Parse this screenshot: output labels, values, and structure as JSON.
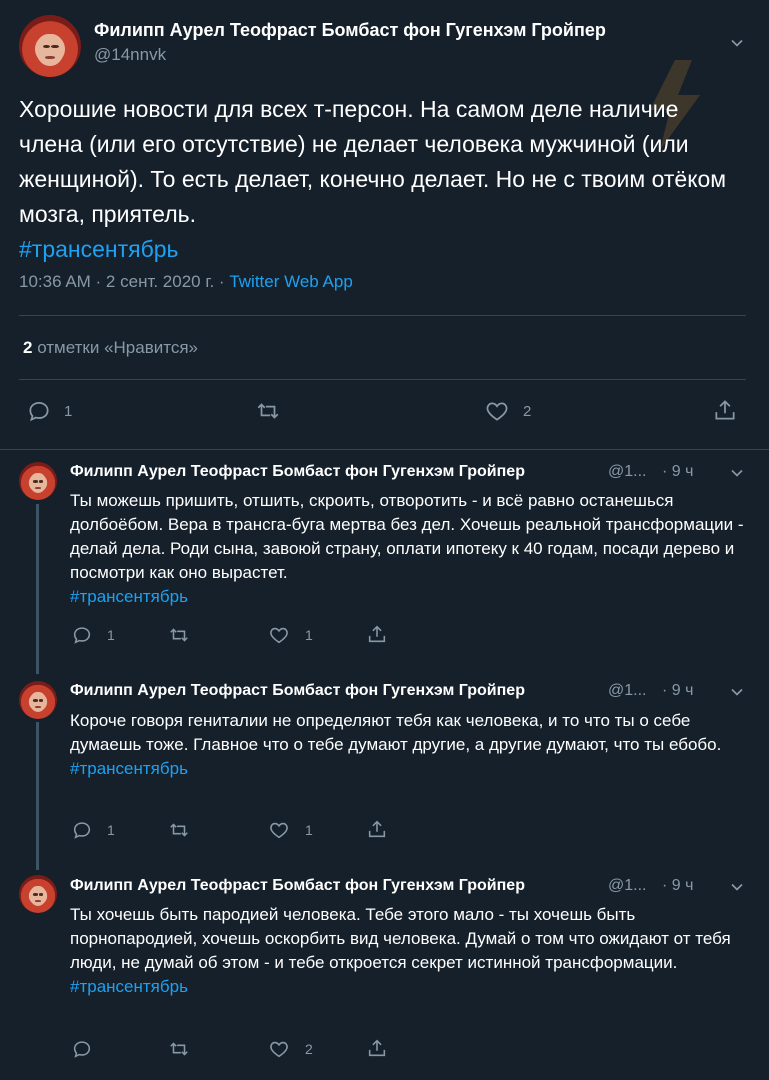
{
  "main_tweet": {
    "display_name": "Филипп Аурел Теофраст Бомбаст фон Гугенхэм Гройпер",
    "handle": "@14nnvk",
    "text": "Хорошие новости для всех т-персон. На самом деле наличие члена (или его отсутствие) не делает человека мужчиной (или женщиной). То есть делает, конечно делает. Но не с твоим отёком мозга, приятель.",
    "hashtag": "#трансентябрь",
    "time": "10:36 AM · 2 сент. 2020 г. · ",
    "source": "Twitter Web App",
    "likes_count": "2",
    "likes_label": " отметки «Нравится»",
    "reply_count": "1",
    "retweet_count": "",
    "like_count": "2"
  },
  "replies": [
    {
      "display_name": "Филипп Аурел Теофраст Бомбаст фон Гугенхэм Гройпер",
      "handle": "@1...",
      "time": "· 9 ч",
      "text": "Ты можешь пришить, отшить, скроить, отворотить - и всё равно останешься долбоёбом. Вера в трансга-буга мертва без дел. Хочешь реальной трансформации - делай дела. Роди сына, завоюй страну, оплати ипотеку к 40 годам, посади дерево и посмотри как оно вырастет.",
      "hashtag": "#трансентябрь",
      "reply_count": "1",
      "retweet_count": "",
      "like_count": "1"
    },
    {
      "display_name": "Филипп Аурел Теофраст Бомбаст фон Гугенхэм Гройпер",
      "handle": "@1...",
      "time": "· 9 ч",
      "text": "Короче говоря гениталии не определяют тебя как человека, и то что ты о себе думаешь тоже. Главное что о тебе думают другие, а другие думают, что ты ебобо.",
      "hashtag": "#трансентябрь",
      "reply_count": "1",
      "retweet_count": "",
      "like_count": "1"
    },
    {
      "display_name": "Филипп Аурел Теофраст Бомбаст фон Гугенхэм Гройпер",
      "handle": "@1...",
      "time": "· 9 ч",
      "text": "Ты хочешь быть пародией человека. Тебе этого мало - ты хочешь быть порнопародией, хочешь оскорбить вид человека. Думай о том что ожидают от тебя люди, не думай об этом - и тебе откроется секрет истинной трансформации.",
      "hashtag": "#трансентябрь",
      "reply_count": "",
      "retweet_count": "",
      "like_count": "2"
    }
  ],
  "icons": {
    "reply": "reply-icon",
    "retweet": "retweet-icon",
    "like": "like-icon",
    "share": "share-icon",
    "more": "chevron-down-icon"
  },
  "colors": {
    "background": "#15202b",
    "text": "#ffffff",
    "muted": "#8899a6",
    "accent": "#1da1f2",
    "divider": "#38444d"
  }
}
